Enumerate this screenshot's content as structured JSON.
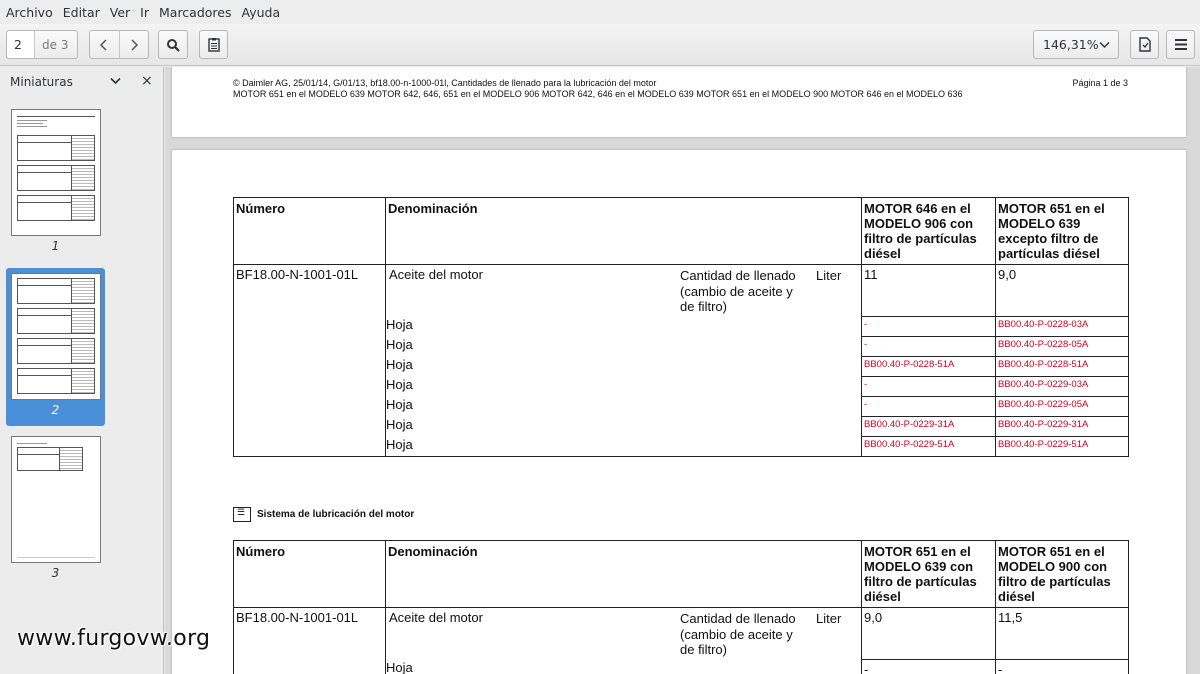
{
  "menu": [
    "Archivo",
    "Editar",
    "Ver",
    "Ir",
    "Marcadores",
    "Ayuda"
  ],
  "toolbar": {
    "page_current": "2",
    "page_total": "de 3",
    "prev_icon": "chevron-left",
    "next_icon": "chevron-right",
    "search_icon": "magnifier",
    "annotations_icon": "clipboard",
    "zoom": "146,31%",
    "zoom_arrow": "⌄",
    "save_icon": "document",
    "menu_icon": "hamburger"
  },
  "sidebar": {
    "title": "Miniaturas",
    "chevron": "⌄",
    "close": "×",
    "thumbnails": [
      {
        "label": "1"
      },
      {
        "label": "2",
        "selected": true
      },
      {
        "label": "3"
      }
    ]
  },
  "document": {
    "header_line1": "© Daimler AG, 25/01/14, G/01/13, bf18.00-n-1000-01l, Cantidades de llenado para la lubricación del motor",
    "header_page": "Página 1 de 3",
    "header_line2": "MOTOR 651 en el MODELO 639 MOTOR 642, 646, 651 en el MODELO 906 MOTOR 642, 646 en el MODELO 639 MOTOR 651 en el MODELO 900 MOTOR 646 en el MODELO 636",
    "table1": {
      "col_numero": "Número",
      "col_denominacion": "Denominación",
      "col_a": "MOTOR 646 en el MODELO 906 con filtro de partículas diésel",
      "col_b": "MOTOR 651 en el MODELO 639 excepto filtro de partículas diésel",
      "numero": "BF18.00-N-1001-01L",
      "denominacion": "Aceite del motor",
      "cantidad": "Cantidad de llenado (cambio de aceite y de filtro)",
      "unit": "Liter",
      "val_a": "11",
      "val_b": "9,0",
      "hoja_label": "Hoja",
      "rows": [
        {
          "a": "-",
          "b": "BB00.40-P-0228-03A"
        },
        {
          "a": "-",
          "b": "BB00.40-P-0228-05A"
        },
        {
          "a": "BB00.40-P-0228-51A",
          "b": "BB00.40-P-0228-51A"
        },
        {
          "a": "-",
          "b": "BB00.40-P-0229-03A"
        },
        {
          "a": "-",
          "b": "BB00.40-P-0229-05A"
        },
        {
          "a": "BB00.40-P-0229-31A",
          "b": "BB00.40-P-0229-31A"
        },
        {
          "a": "BB00.40-P-0229-51A",
          "b": "BB00.40-P-0229-51A"
        }
      ]
    },
    "section_title": "Sistema de lubricación del motor",
    "table2": {
      "col_numero": "Número",
      "col_denominacion": "Denominación",
      "col_a": "MOTOR 651 en el MODELO 639 con filtro de partículas diésel",
      "col_b": "MOTOR 651 en el MODELO 900 con filtro de partículas diésel",
      "numero": "BF18.00-N-1001-01L",
      "denominacion": "Aceite del motor",
      "cantidad": "Cantidad de llenado (cambio de aceite y de filtro)",
      "unit": "Liter",
      "val_a": "9,0",
      "val_b": "11,5",
      "hoja_label": "Hoja",
      "row1_a": "-",
      "row1_b": "-"
    }
  },
  "watermark": "www.furgovw.org"
}
